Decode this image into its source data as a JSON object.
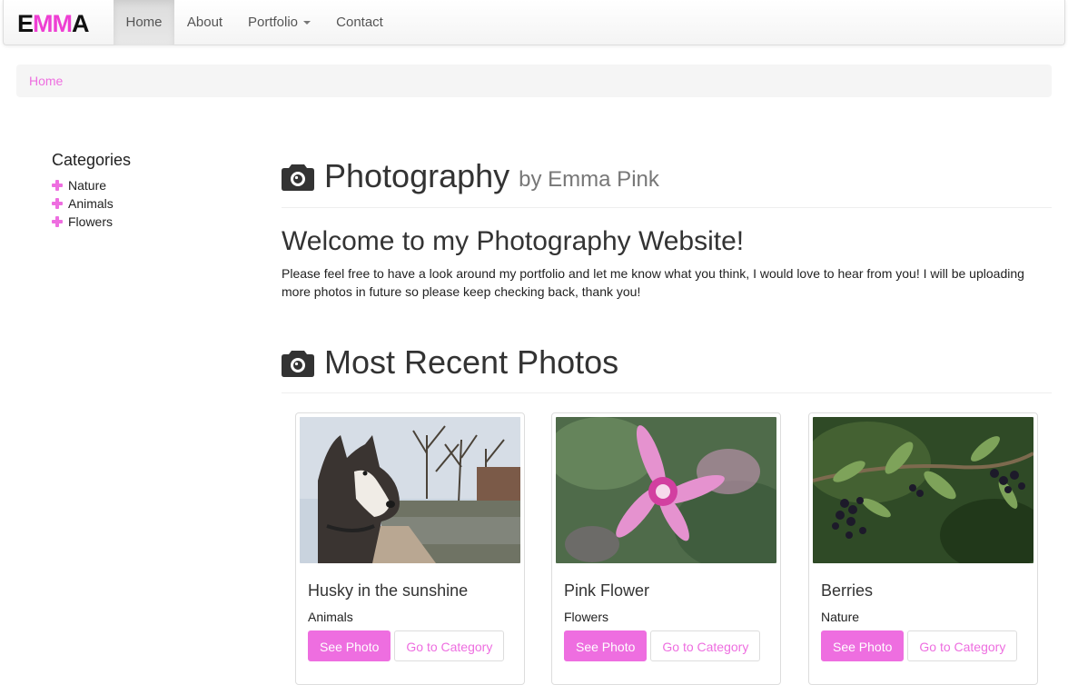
{
  "brand": {
    "text": "EMMA"
  },
  "nav": {
    "items": [
      {
        "label": "Home",
        "active": true
      },
      {
        "label": "About"
      },
      {
        "label": "Portfolio",
        "dropdown": true
      },
      {
        "label": "Contact"
      }
    ]
  },
  "breadcrumb": {
    "current": "Home"
  },
  "sidebar": {
    "heading": "Categories",
    "items": [
      {
        "label": "Nature",
        "icon": "plus-icon"
      },
      {
        "label": "Animals",
        "icon": "plus-icon"
      },
      {
        "label": "Flowers",
        "icon": "plus-icon"
      }
    ]
  },
  "header": {
    "title": "Photography",
    "subtitle": "by Emma Pink",
    "icon": "camera-icon"
  },
  "welcome": {
    "title": "Welcome to my Photography Website!",
    "text": "Please feel free to have a look around my portfolio and let me know what you think, I would love to hear from you! I will be uploading more photos in future so please keep checking back, thank you!"
  },
  "recent": {
    "title": "Most Recent Photos",
    "icon": "camera-icon",
    "photos": [
      {
        "title": "Husky in the sunshine",
        "category": "Animals",
        "see_label": "See Photo",
        "goto_label": "Go to Category"
      },
      {
        "title": "Pink Flower",
        "category": "Flowers",
        "see_label": "See Photo",
        "goto_label": "Go to Category"
      },
      {
        "title": "Berries",
        "category": "Nature",
        "see_label": "See Photo",
        "goto_label": "Go to Category"
      }
    ]
  },
  "colors": {
    "accent": "#ee6ee0",
    "brand_pink": "#ee3fd3"
  }
}
